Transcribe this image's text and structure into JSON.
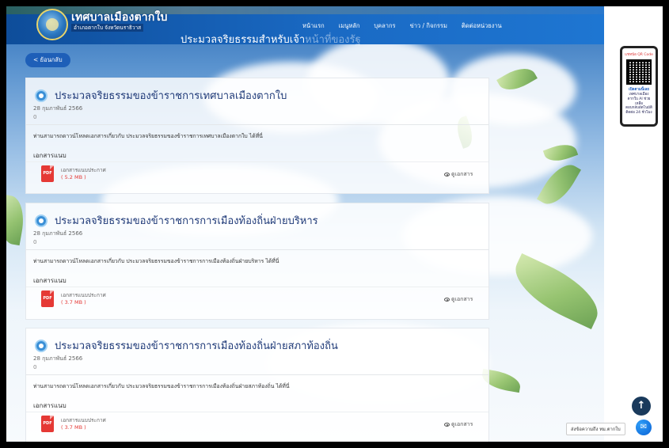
{
  "header": {
    "logo_title": "เทศบาลเมืองตากใบ",
    "logo_subtitle": "อำเภอตากใบ จังหวัดนราธิวาส",
    "page_title_main": "ประมวลจริยธรรมสำหรับเจ้า",
    "page_title_faded": "หน้าที่ของรัฐ",
    "nav": [
      "หน้าแรก",
      "เมนูหลัก",
      "บุคลากร",
      "ข่าว / กิจกรรม",
      "ติดต่อหน่วยงาน"
    ]
  },
  "back_button": "< ย้อนกลับ",
  "qr_panel": {
    "heading": "แชทน้อ QR Code",
    "line1": "เปิดตามนี้เลย",
    "line2": "เทศบาลเมือง ตากใบ AI ช่วยเหลือ",
    "line3": "ตอบกลับอัตโนมัติ ติดต่อ 24 ชั่วโมง"
  },
  "cards": [
    {
      "title": "ประมวลจริยธรรมของข้าราชการเทศบาลเมืองตากใบ",
      "date": "28 กุมภาพันธ์ 2566",
      "views": "0",
      "description": "ท่านสามารถดาวน์โหลดเอกสารเกี่ยวกับ ประมวลจริยธรรมของข้าราชการเทศบาลเมืองตากใบ ได้ที่นี่",
      "attachments_heading": "เอกสารแนบ",
      "file_type": "PDF",
      "file_name": "เอกสารแนบประกาศ",
      "file_size": "( 5.2 MB )",
      "view_label": "ดูเอกสาร"
    },
    {
      "title": "ประมวลจริยธรรมของข้าราชการการเมืองท้องถิ่นฝ่ายบริหาร",
      "date": "28 กุมภาพันธ์ 2566",
      "views": "0",
      "description": "ท่านสามารถดาวน์โหลดเอกสารเกี่ยวกับ ประมวลจริยธรรมของข้าราชการการเมืองท้องถิ่นฝ่ายบริหาร ได้ที่นี่",
      "attachments_heading": "เอกสารแนบ",
      "file_type": "PDF",
      "file_name": "เอกสารแนบประกาศ",
      "file_size": "( 3.7 MB )",
      "view_label": "ดูเอกสาร"
    },
    {
      "title": "ประมวลจริยธรรมของข้าราชการการเมืองท้องถิ่นฝ่ายสภาท้องถิ่น",
      "date": "28 กุมภาพันธ์ 2566",
      "views": "0",
      "description": "ท่านสามารถดาวน์โหลดเอกสารเกี่ยวกับ ประมวลจริยธรรมของข้าราชการการเมืองท้องถิ่นฝ่ายสภาท้องถิ่น ได้ที่นี่",
      "attachments_heading": "เอกสารแนบ",
      "file_type": "PDF",
      "file_name": "เอกสารแนบประกาศ",
      "file_size": "( 3.7 MB )",
      "view_label": "ดูเอกสาร"
    }
  ],
  "scroll_top_icon": "arrow-up-icon",
  "chat_label": "ส่งข้อความถึง ทม.ตากใบ",
  "messenger_icon": "messenger-icon"
}
